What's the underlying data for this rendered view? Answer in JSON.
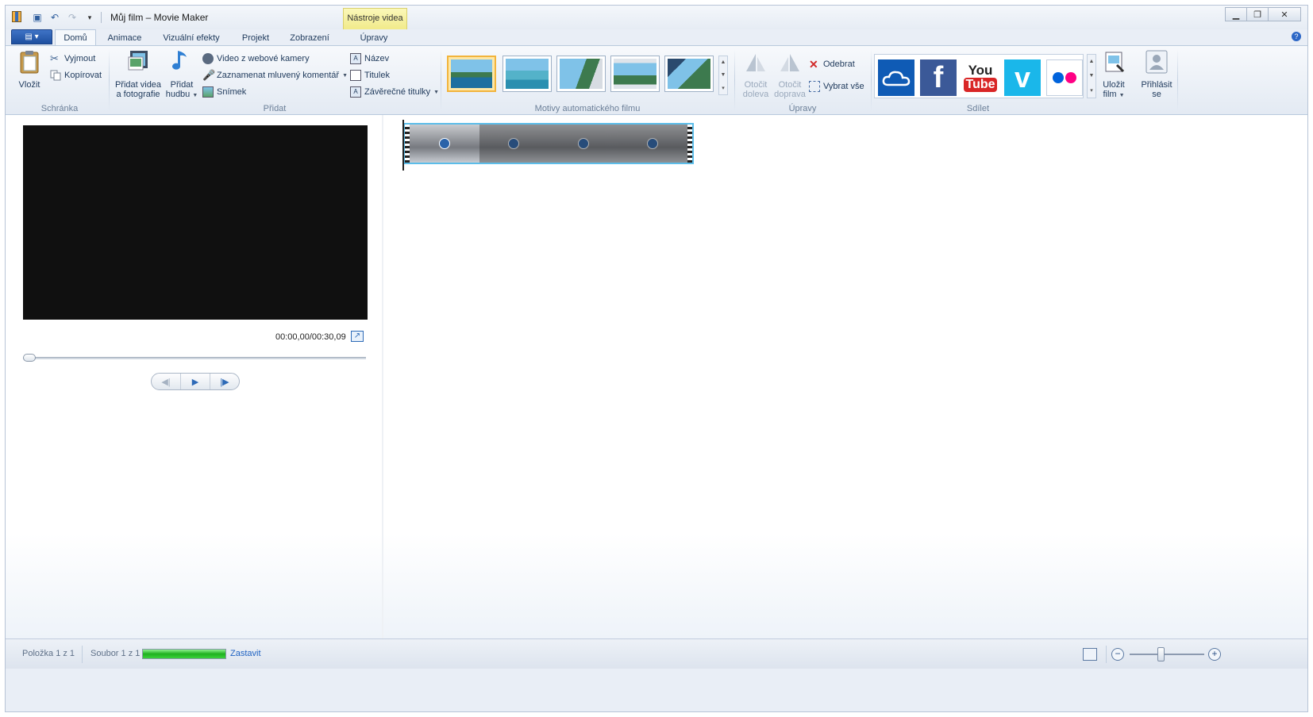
{
  "window": {
    "title": "Můj film – Movie Maker",
    "context_tab_header": "Nástroje videa",
    "buttons": {
      "minimize": "–",
      "maximize": "▫",
      "close": "✕"
    }
  },
  "qat": {
    "save": "💾",
    "undo": "↶",
    "redo": "↷",
    "customize": "▾"
  },
  "tabs": [
    "Domů",
    "Animace",
    "Vizuální efekty",
    "Projekt",
    "Zobrazení",
    "Úpravy"
  ],
  "ribbon": {
    "clipboard": {
      "label": "Schránka",
      "paste": "Vložit",
      "cut": "Vyjmout",
      "copy": "Kopírovat"
    },
    "add": {
      "label": "Přidat",
      "add_videos_1": "Přidat videa",
      "add_videos_2": "a fotografie",
      "add_music_1": "Přidat",
      "add_music_2": "hudbu",
      "webcam": "Video z webové kamery",
      "narration": "Zaznamenat mluvený komentář",
      "snapshot": "Snímek",
      "title": "Název",
      "caption": "Titulek",
      "credits": "Závěrečné titulky"
    },
    "themes": {
      "label": "Motivy automatického filmu"
    },
    "editing": {
      "label": "Úpravy",
      "rotate_left_1": "Otočit",
      "rotate_left_2": "doleva",
      "rotate_right_1": "Otočit",
      "rotate_right_2": "doprava",
      "remove": "Odebrat",
      "select_all": "Vybrat vše"
    },
    "share": {
      "label": "Sdílet",
      "save_movie_1": "Uložit",
      "save_movie_2": "film",
      "signin_1": "Přihlásit",
      "signin_2": "se"
    }
  },
  "preview": {
    "timecode": "00:00,00/00:30,09"
  },
  "status": {
    "item": "Položka 1 z 1",
    "file": "Soubor 1 z 1",
    "progress": 1.0,
    "stop": "Zastavit"
  },
  "colors": {
    "accent": "#2d67c6",
    "progress": "#1fb11f",
    "selection": "#5cbde9"
  }
}
